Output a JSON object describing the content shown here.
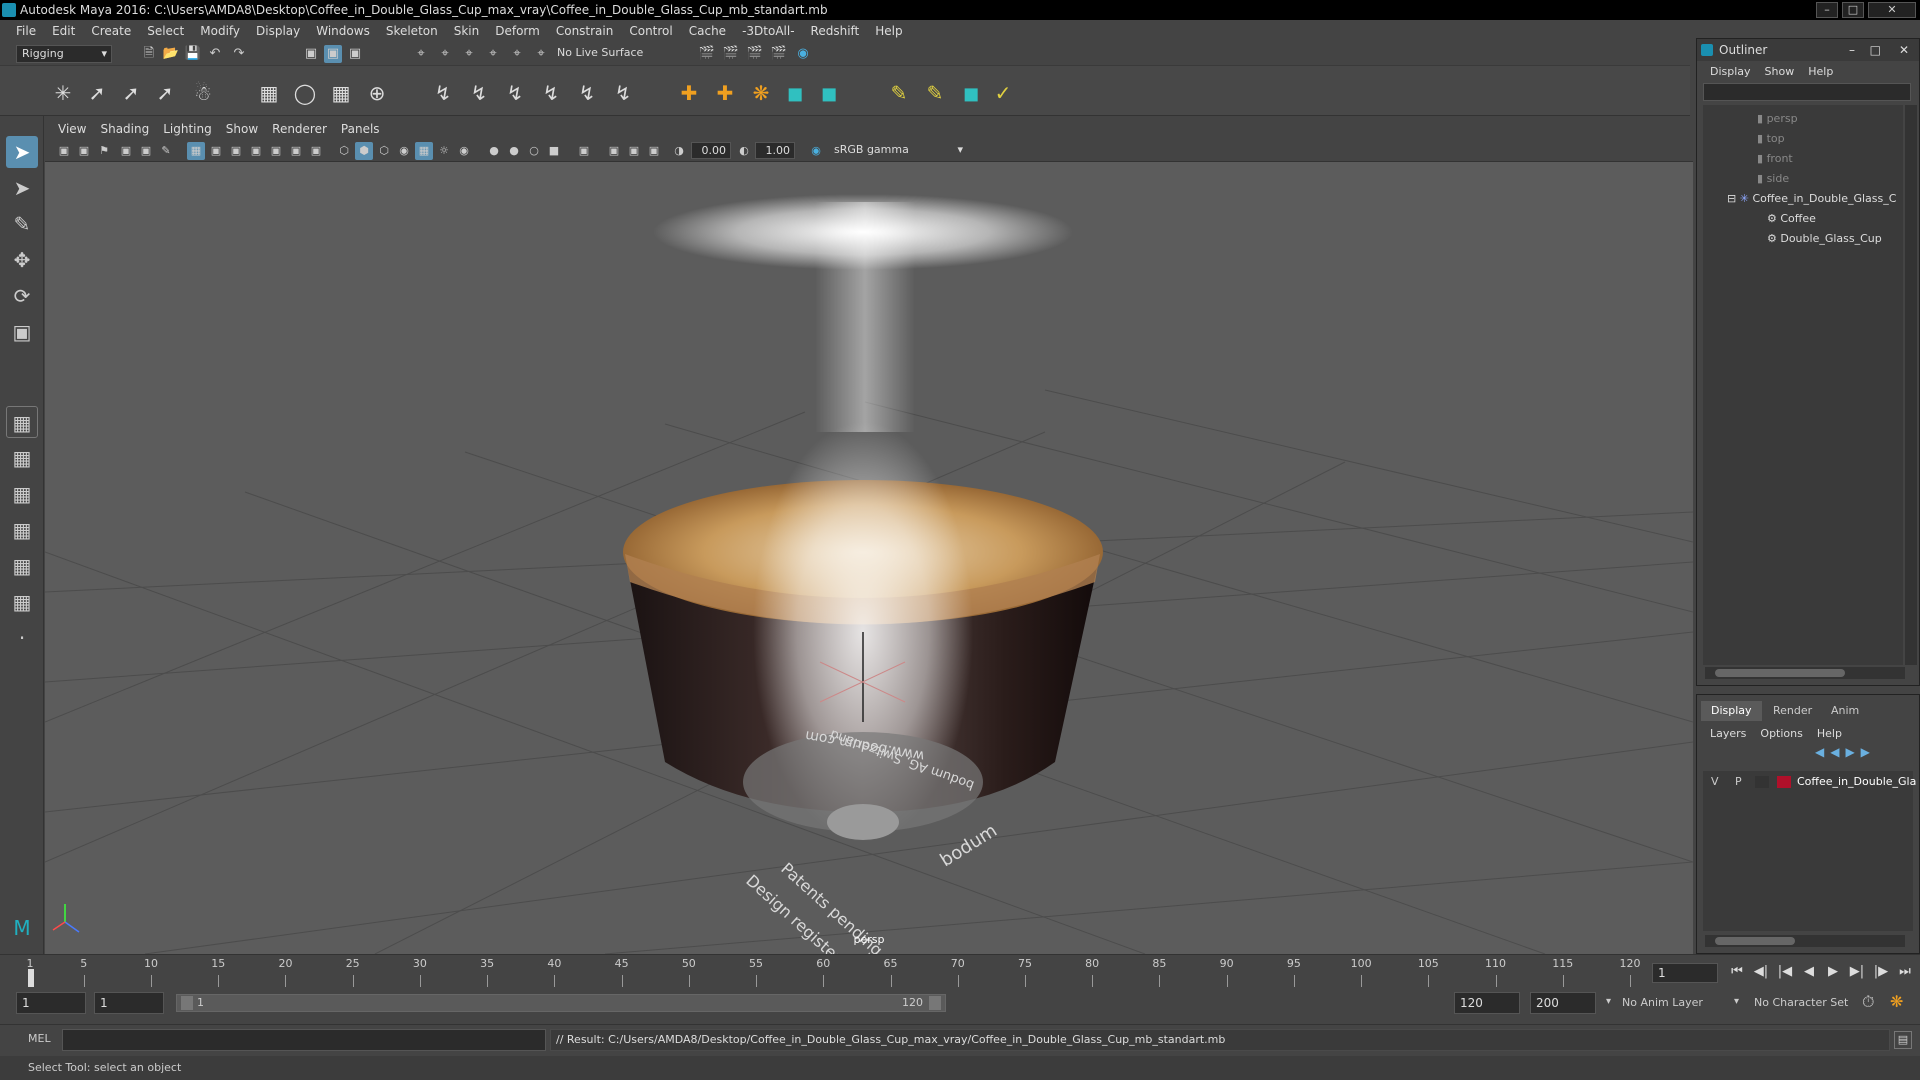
{
  "window": {
    "title": "Autodesk Maya 2016: C:\\Users\\AMDA8\\Desktop\\Coffee_in_Double_Glass_Cup_max_vray\\Coffee_in_Double_Glass_Cup_mb_standart.mb"
  },
  "menu": [
    "File",
    "Edit",
    "Create",
    "Select",
    "Modify",
    "Display",
    "Windows",
    "Skeleton",
    "Skin",
    "Deform",
    "Constrain",
    "Control",
    "Cache",
    "-3DtoAll-",
    "Redshift",
    "Help"
  ],
  "statusline": {
    "mode": "Rigging",
    "live_surface": "No Live Surface"
  },
  "viewport": {
    "menu": [
      "View",
      "Shading",
      "Lighting",
      "Show",
      "Renderer",
      "Panels"
    ],
    "exposure": "0.00",
    "gamma": "1.00",
    "colorspace": "sRGB gamma",
    "camera": "persp",
    "decal_text": [
      "Design registered in Switzerland",
      "Patents pending",
      "www.bodum.com",
      "bodum",
      "bodum AG, Switzerland"
    ]
  },
  "outliner": {
    "title": "Outliner",
    "menu": [
      "Display",
      "Show",
      "Help"
    ],
    "items": [
      {
        "label": "persp"
      },
      {
        "label": "top"
      },
      {
        "label": "front"
      },
      {
        "label": "side"
      },
      {
        "label": "Coffee_in_Double_Glass_C"
      },
      {
        "label": "Coffee"
      },
      {
        "label": "Double_Glass_Cup"
      }
    ]
  },
  "layers": {
    "tabs": [
      "Display",
      "Render",
      "Anim"
    ],
    "menu": [
      "Layers",
      "Options",
      "Help"
    ],
    "layer": {
      "v": "V",
      "p": "P",
      "name": "Coffee_in_Double_Gla",
      "color": "#b0102a"
    }
  },
  "timeline": {
    "ticks": [
      "1",
      "5",
      "10",
      "15",
      "20",
      "25",
      "30",
      "35",
      "40",
      "45",
      "50",
      "55",
      "60",
      "65",
      "70",
      "75",
      "80",
      "85",
      "90",
      "95",
      "100",
      "105",
      "110",
      "115",
      "120"
    ],
    "current_frame": "1"
  },
  "range": {
    "start": "1",
    "playback_start": "1",
    "slider_start": "1",
    "slider_end": "120",
    "playback_end": "120",
    "end": "200",
    "anim_layer": "No Anim Layer",
    "char_set": "No Character Set"
  },
  "cmd": {
    "lang": "MEL",
    "result": "// Result: C:/Users/AMDA8/Desktop/Coffee_in_Double_Glass_Cup_max_vray/Coffee_in_Double_Glass_Cup_mb_standart.mb"
  },
  "help": "Select Tool: select an object",
  "colors": {
    "accent": "#1a8fb0",
    "bg": "#444444",
    "viewport": "#5c5c5c"
  }
}
